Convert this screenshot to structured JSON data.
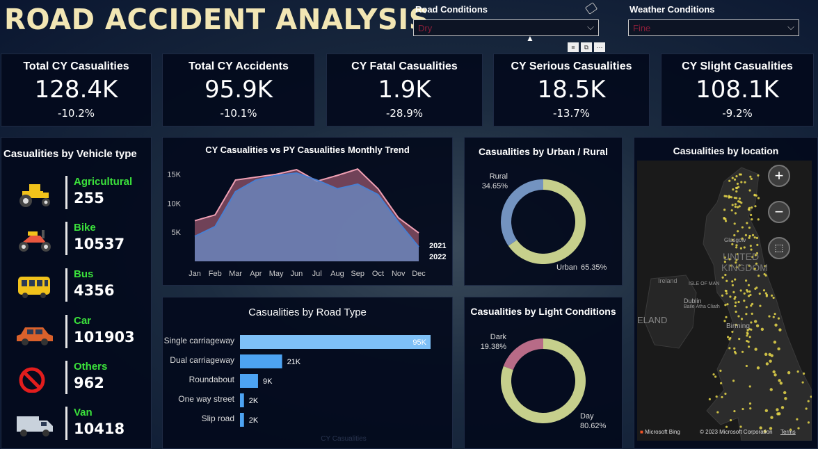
{
  "title": "ROAD ACCIDENT ANALYSIS",
  "filters": {
    "road": {
      "label": "Road Conditions",
      "value": "Dry"
    },
    "weather": {
      "label": "Weather Conditions",
      "value": "Fine"
    }
  },
  "toolbar": {
    "filter_icon": "filter-icon",
    "focus_icon": "focus-mode-icon",
    "more": "···"
  },
  "kpis": [
    {
      "title": "Total CY Casualities",
      "value": "128.4K",
      "delta": "-10.2%"
    },
    {
      "title": "Total CY Accidents",
      "value": "95.9K",
      "delta": "-10.1%"
    },
    {
      "title": "CY Fatal Casualities",
      "value": "1.9K",
      "delta": "-28.9%"
    },
    {
      "title": "CY Serious Casualities",
      "value": "18.5K",
      "delta": "-13.7%"
    },
    {
      "title": "CY Slight Casualities",
      "value": "108.1K",
      "delta": "-9.2%"
    }
  ],
  "vehicles": {
    "title": "Casualities by Vehicle type",
    "items": [
      {
        "name": "Agricultural",
        "value": "255",
        "icon": "tractor-icon"
      },
      {
        "name": "Bike",
        "value": "10537",
        "icon": "bike-icon"
      },
      {
        "name": "Bus",
        "value": "4356",
        "icon": "bus-icon"
      },
      {
        "name": "Car",
        "value": "101903",
        "icon": "car-icon"
      },
      {
        "name": "Others",
        "value": "962",
        "icon": "no-entry-icon"
      },
      {
        "name": "Van",
        "value": "10418",
        "icon": "van-icon"
      }
    ]
  },
  "colors": {
    "cy": "#6a8ec8",
    "py": "#c96f86",
    "bar": "#4da3f2",
    "bar_highlight": "#7ec0f7",
    "donut_light": "#c6cf8c",
    "donut_blue": "#7393c0",
    "donut_pink": "#b86b87",
    "vehicle_name": "#3be23b",
    "title": "#f2e6b4"
  },
  "map": {
    "title": "Casualities by location",
    "labels": {
      "uk": "UNITED",
      "kingdom": "KINGDOM",
      "ireland": "Ireland",
      "isle": "ISLE OF MAN",
      "dublin": "Dublin",
      "baile": "Baile Átha Cliath",
      "eland": "ELAND",
      "birm": "Birming",
      "glasgow": "Glasgow"
    },
    "attribution": "Microsoft Bing",
    "copyright": "© 2023 Microsoft Corporation",
    "terms": "Terms",
    "zoom_in": "+",
    "zoom_out": "−"
  },
  "chart_data": [
    {
      "type": "area",
      "title": "CY Casualities vs PY Casualities Monthly Trend",
      "categories": [
        "Jan",
        "Feb",
        "Mar",
        "Apr",
        "May",
        "Jun",
        "Jul",
        "Aug",
        "Sep",
        "Oct",
        "Nov",
        "Dec"
      ],
      "series": [
        {
          "name": "2021",
          "values": [
            7000,
            8000,
            14000,
            14500,
            15000,
            15800,
            13800,
            14800,
            15900,
            12500,
            7500,
            4900
          ]
        },
        {
          "name": "2022",
          "values": [
            4300,
            6000,
            12000,
            14000,
            14800,
            15200,
            14000,
            12500,
            13300,
            11500,
            6800,
            2500
          ]
        }
      ],
      "yticks": [
        "5K",
        "10K",
        "15K"
      ],
      "ylim": [
        0,
        17000
      ]
    },
    {
      "type": "pie",
      "title": "Casualities by Urban / Rural",
      "labels": [
        "Rural",
        "Urban"
      ],
      "values": [
        34.65,
        65.35
      ],
      "display": [
        "34.65%",
        "65.35%"
      ]
    },
    {
      "type": "bar",
      "title": "Casualities by Road Type",
      "categories": [
        "Single carriageway",
        "Dual carriageway",
        "Roundabout",
        "One way street",
        "Slip road"
      ],
      "values": [
        95,
        21,
        9,
        2,
        2
      ],
      "data_labels": [
        "95K",
        "21K",
        "9K",
        "2K",
        "2K"
      ],
      "xlabel": "CY Casualities"
    },
    {
      "type": "pie",
      "title": "Casualities by Light Conditions",
      "labels": [
        "Dark",
        "Day"
      ],
      "values": [
        19.38,
        80.62
      ],
      "display": [
        "19.38%",
        "80.62%"
      ]
    }
  ]
}
